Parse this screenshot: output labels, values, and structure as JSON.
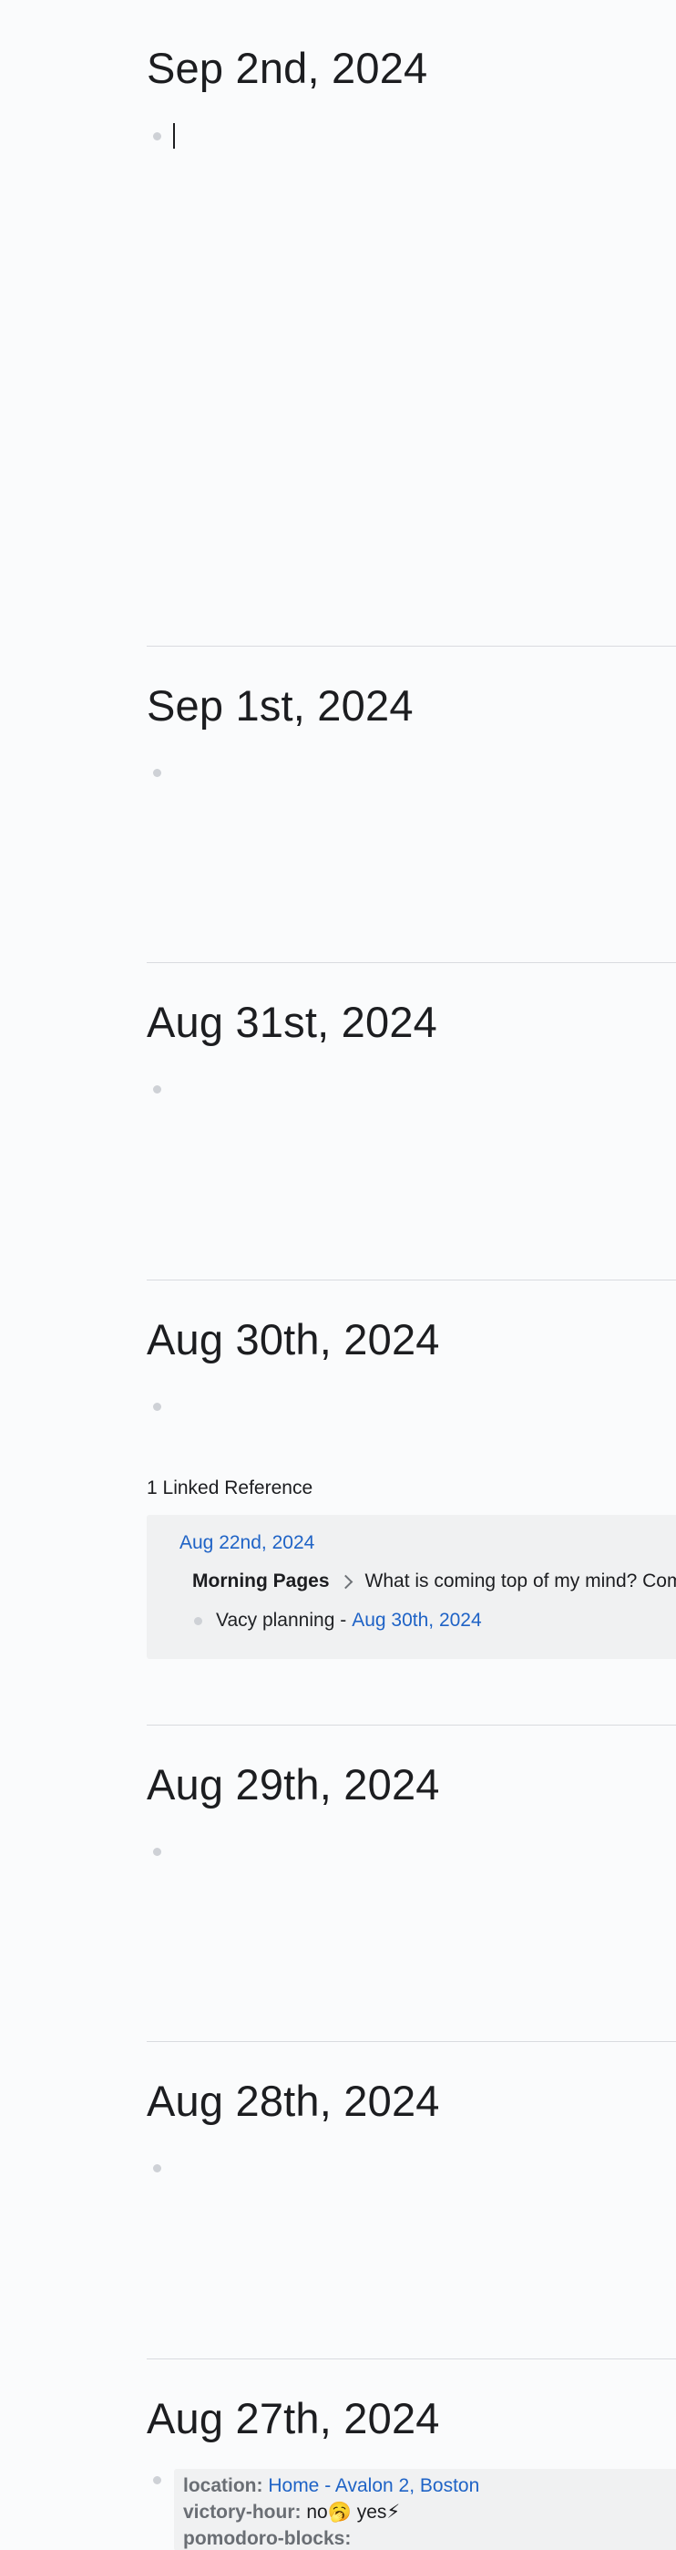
{
  "journals": [
    {
      "title": "Sep 2nd, 2024"
    },
    {
      "title": "Sep 1st, 2024"
    },
    {
      "title": "Aug 31st, 2024"
    },
    {
      "title": "Aug 30th, 2024",
      "linked_refs": {
        "header": "1 Linked Reference",
        "page": "Aug 22nd, 2024",
        "breadcrumb_parent": "Morning Pages",
        "breadcrumb_child": "What is coming top of my mind? Com",
        "child_text": "Vacy planning - ",
        "child_link": "Aug 30th, 2024"
      }
    },
    {
      "title": "Aug 29th, 2024"
    },
    {
      "title": "Aug 28th, 2024"
    },
    {
      "title": "Aug 27th, 2024",
      "properties": {
        "location_key": "location:",
        "location_value": "Home - Avalon 2, Boston",
        "victory_key": "victory-hour:",
        "victory_value": " no🥱 yes⚡",
        "pomodoro_key": "pomodoro-blocks:",
        "pomodoro_value": ""
      }
    }
  ]
}
